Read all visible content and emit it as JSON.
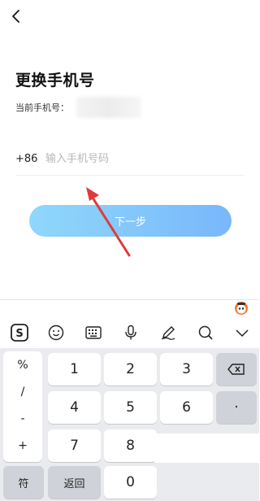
{
  "header": {
    "back_icon": "chevron-left-icon"
  },
  "page": {
    "title": "更换手机号",
    "current_phone_label": "当前手机号："
  },
  "form": {
    "country_code": "+86",
    "phone_placeholder": "输入手机号码",
    "phone_value": "",
    "next_button": "下一步"
  },
  "keyboard": {
    "toolbar_icons": [
      "sogou-logo-icon",
      "emoji-icon",
      "keyboard-icon",
      "microphone-icon",
      "handwriting-icon",
      "search-icon",
      "chevron-down-icon"
    ],
    "symbols": [
      "%",
      "/",
      "-",
      "+"
    ],
    "digits_row1": [
      "1",
      "2",
      "3"
    ],
    "digits_row2": [
      "4",
      "5",
      "6"
    ],
    "digits_row3": [
      "7",
      "8"
    ],
    "dot_key": "·",
    "bottom": {
      "symbol_key": "符",
      "return_key": "返回",
      "zero_key": "0"
    }
  },
  "colors": {
    "button_gradient_start": "#8fd8fb",
    "button_gradient_end": "#79b7fb",
    "arrow": "#e03a3a"
  }
}
